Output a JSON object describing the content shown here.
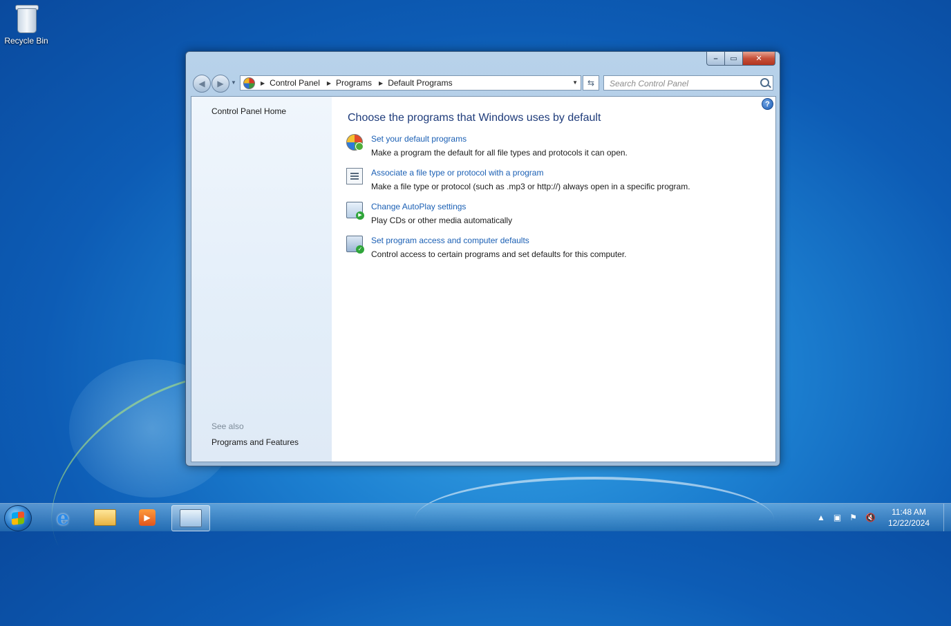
{
  "desktop": {
    "recycle_bin_label": "Recycle Bin"
  },
  "window": {
    "caption_buttons": {
      "minimize": "–",
      "maximize": "▭",
      "close": "✕"
    },
    "address": {
      "crumbs": [
        "Control Panel",
        "Programs",
        "Default Programs"
      ]
    },
    "search": {
      "placeholder": "Search Control Panel"
    },
    "left_pane": {
      "home_link": "Control Panel Home",
      "see_also_label": "See also",
      "programs_features_link": "Programs and Features"
    },
    "main": {
      "heading": "Choose the programs that Windows uses by default",
      "tasks": [
        {
          "link": "Set your default programs",
          "desc": "Make a program the default for all file types and protocols it can open.",
          "icon": "default-programs-icon"
        },
        {
          "link": "Associate a file type or protocol with a program",
          "desc": "Make a file type or protocol (such as .mp3 or http://) always open in a specific program.",
          "icon": "file-association-icon"
        },
        {
          "link": "Change AutoPlay settings",
          "desc": "Play CDs or other media automatically",
          "icon": "autoplay-icon"
        },
        {
          "link": "Set program access and computer defaults",
          "desc": "Control access to certain programs and set defaults for this computer.",
          "icon": "program-access-icon"
        }
      ]
    }
  },
  "taskbar": {
    "clock_time": "11:48 AM",
    "clock_date": "12/22/2024"
  }
}
